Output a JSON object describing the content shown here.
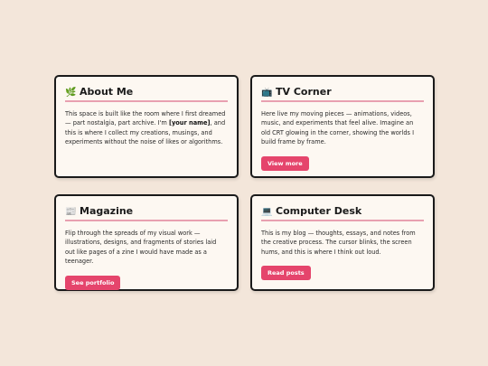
{
  "cards": {
    "about": {
      "icon": "leaf-icon",
      "title": "About Me",
      "body_pre": "This space is built like the room where I first dreamed — part nostalgia, part archive. I'm ",
      "body_bold": "[your name]",
      "body_post": ", and this is where I collect my creations, musings, and experiments without the noise of likes or algorithms."
    },
    "tv": {
      "icon": "tv-icon",
      "title": "TV Corner",
      "body": "Here live my moving pieces — animations, videos, music, and experiments that feel alive. Imagine an old CRT glowing in the corner, showing the worlds I build frame by frame.",
      "button": "View more"
    },
    "magazine": {
      "icon": "newspaper-icon",
      "title": "Magazine",
      "body": "Flip through the spreads of my visual work — illustrations, designs, and fragments of stories laid out like pages of a zine I would have made as a teenager.",
      "button": "See portfolio"
    },
    "desk": {
      "icon": "laptop-icon",
      "title": "Computer Desk",
      "body": "This is my blog — thoughts, essays, and notes from the creative process. The cursor blinks, the screen hums, and this is where I think out loud.",
      "button": "Read posts"
    }
  },
  "colors": {
    "page_background": "#f3e6da",
    "card_background": "#fdf8f2",
    "accent_button": "#e5456c",
    "title_underline": "#e8a0b0"
  }
}
